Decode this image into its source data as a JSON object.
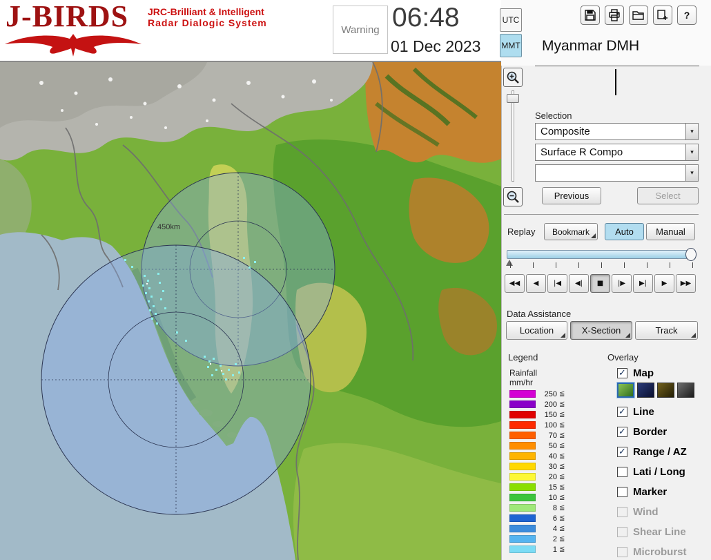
{
  "header": {
    "logo": {
      "title": "J-BIRDS",
      "subtitle1": "JRC-Brilliant & Intelligent",
      "subtitle2": "Radar  Dialogic  System"
    },
    "warning_label": "Warning",
    "clock": {
      "time": "06:48",
      "date": "01 Dec 2023"
    },
    "timezone": {
      "utc": "UTC",
      "mmt": "MMT",
      "selected": "MMT"
    },
    "toolbar_icons": [
      "save-icon",
      "print-icon",
      "open-folder-icon",
      "export-icon",
      "help-icon"
    ],
    "org_name": "Myanmar DMH"
  },
  "map": {
    "range_ring_label": "450km"
  },
  "panel": {
    "selection": {
      "label": "Selection",
      "dropdown1": "Composite",
      "dropdown2": "Surface R Compo",
      "dropdown3": "",
      "previous": "Previous",
      "select": "Select"
    },
    "replay": {
      "label": "Replay",
      "bookmark": "Bookmark",
      "auto": "Auto",
      "manual": "Manual",
      "auto_selected": true,
      "transport": [
        "◀◀",
        "◀",
        "|◀",
        "◀|",
        "■",
        "|▶",
        "▶|",
        "▶",
        "▶▶"
      ],
      "transport_active_index": 4
    },
    "data_assistance": {
      "label": "Data Assistance",
      "location": "Location",
      "xsection": "X-Section",
      "track": "Track",
      "active": "X-Section"
    },
    "legend": {
      "label": "Legend",
      "unit_title": "Rainfall",
      "unit": "mm/hr",
      "suffix": "≦",
      "rows": [
        {
          "value": "250",
          "color": "#d400d4"
        },
        {
          "value": "200",
          "color": "#8a00c8"
        },
        {
          "value": "150",
          "color": "#e00000"
        },
        {
          "value": "100",
          "color": "#ff2a00"
        },
        {
          "value": "70",
          "color": "#ff5f00"
        },
        {
          "value": "50",
          "color": "#ff8e00"
        },
        {
          "value": "40",
          "color": "#ffb400"
        },
        {
          "value": "30",
          "color": "#ffd800"
        },
        {
          "value": "20",
          "color": "#fdf835"
        },
        {
          "value": "15",
          "color": "#8ade00"
        },
        {
          "value": "10",
          "color": "#3cc43c"
        },
        {
          "value": "8",
          "color": "#9fe879"
        },
        {
          "value": "6",
          "color": "#1e64d2"
        },
        {
          "value": "4",
          "color": "#3c8cdc"
        },
        {
          "value": "2",
          "color": "#55b4f0"
        },
        {
          "value": "1",
          "color": "#7cdcf5"
        }
      ]
    },
    "overlay": {
      "label": "Overlay",
      "items": [
        {
          "label": "Map",
          "checked": true,
          "enabled": true
        },
        {
          "label": "Line",
          "checked": true,
          "enabled": true
        },
        {
          "label": "Border",
          "checked": true,
          "enabled": true
        },
        {
          "label": "Range / AZ",
          "checked": true,
          "enabled": true
        },
        {
          "label": "Lati / Long",
          "checked": false,
          "enabled": true
        },
        {
          "label": "Marker",
          "checked": false,
          "enabled": true
        },
        {
          "label": "Wind",
          "checked": false,
          "enabled": false
        },
        {
          "label": "Shear Line",
          "checked": false,
          "enabled": false
        },
        {
          "label": "Microburst",
          "checked": false,
          "enabled": false
        }
      ],
      "map_styles": [
        {
          "name": "terrain",
          "colors": [
            "#8cc455",
            "#2f6e1e"
          ],
          "selected": true
        },
        {
          "name": "navy",
          "colors": [
            "#2a3a78",
            "#0b1030"
          ],
          "selected": false
        },
        {
          "name": "olive",
          "colors": [
            "#71601c",
            "#241e05"
          ],
          "selected": false
        },
        {
          "name": "dark",
          "colors": [
            "#6e6e6e",
            "#1c1c1c"
          ],
          "selected": false
        }
      ]
    }
  }
}
